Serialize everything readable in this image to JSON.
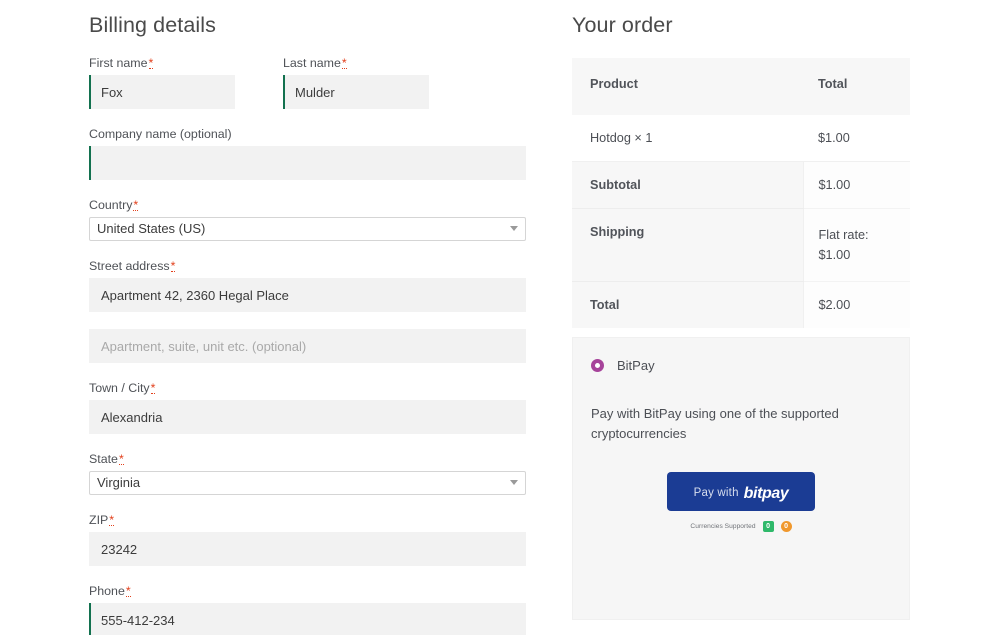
{
  "billing": {
    "title": "Billing details",
    "fields": [
      {
        "label": "First name",
        "required": true,
        "value": "Fox",
        "type": "text",
        "accent": true
      },
      {
        "label": "Last name",
        "required": true,
        "value": "Mulder",
        "type": "text",
        "accent": true
      },
      {
        "label": "Company name (optional)",
        "required": false,
        "value": "",
        "type": "text",
        "accent": true
      },
      {
        "label": "Country",
        "required": true,
        "value": "United States (US)",
        "type": "select"
      },
      {
        "label": "Street address",
        "required": true,
        "value": "Apartment 42, 2360 Hegal Place",
        "type": "text",
        "accent": false
      },
      {
        "label": "",
        "required": false,
        "value": "",
        "placeholder": "Apartment, suite, unit etc. (optional)",
        "type": "text",
        "accent": false
      },
      {
        "label": "Town / City",
        "required": true,
        "value": "Alexandria",
        "type": "text",
        "accent": false
      },
      {
        "label": "State",
        "required": true,
        "value": "Virginia",
        "type": "select"
      },
      {
        "label": "ZIP",
        "required": true,
        "value": "23242",
        "type": "text",
        "accent": false
      },
      {
        "label": "Phone",
        "required": true,
        "value": "555-412-234",
        "type": "text",
        "accent": true
      }
    ],
    "required_marker": "*"
  },
  "order": {
    "title": "Your order",
    "columns": {
      "product": "Product",
      "total": "Total"
    },
    "items": [
      {
        "name": "Hotdog  × 1",
        "total": "$1.00"
      }
    ],
    "summary": [
      {
        "label": "Subtotal",
        "value": "$1.00",
        "value2": ""
      },
      {
        "label": "Shipping",
        "value": "Flat rate:",
        "value2": "$1.00"
      },
      {
        "label": "Total",
        "value": "$2.00",
        "value2": ""
      }
    ]
  },
  "payment": {
    "method_label": "BitPay",
    "description": "Pay with BitPay using one of the supported cryptocurrencies",
    "button": {
      "prefix": "Pay with",
      "brand": "bitpay"
    },
    "currencies_label": "Currencies Supported",
    "coins": [
      {
        "name": "bitcoin-cash",
        "symbol": "0",
        "color": "#2fb96a"
      },
      {
        "name": "bitcoin",
        "symbol": "0",
        "color": "#f0982d"
      }
    ]
  },
  "colors": {
    "accent_green": "#13714f",
    "required_red": "#e2401c",
    "radio_purple": "#a6439a",
    "bitpay_blue": "#1b3c94"
  }
}
